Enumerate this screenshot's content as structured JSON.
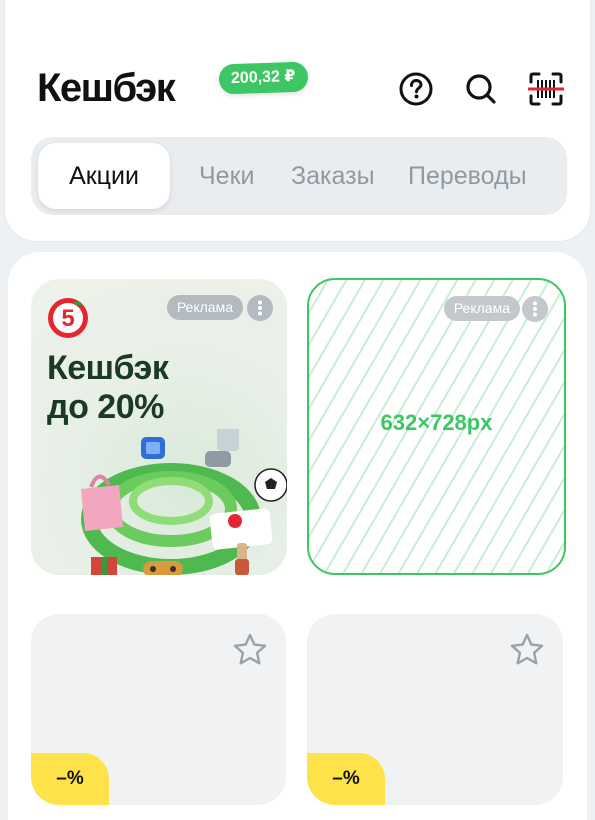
{
  "header": {
    "title": "Кешбэк",
    "balance": "200,32 ₽",
    "icons": [
      "help-icon",
      "search-icon",
      "scan-icon"
    ]
  },
  "tabs": [
    {
      "label": "Акции",
      "active": true
    },
    {
      "label": "Чеки",
      "active": false
    },
    {
      "label": "Заказы",
      "active": false
    },
    {
      "label": "Переводы",
      "active": false
    }
  ],
  "promo_card": {
    "ad_label": "Реклама",
    "logo_text": "5",
    "headline_line1": "Кешбэк",
    "headline_line2": "до 20%"
  },
  "placeholder_card": {
    "ad_label": "Реклама",
    "size_text": "632×728px"
  },
  "offers": [
    {
      "discount": "–%"
    },
    {
      "discount": "–%"
    }
  ],
  "colors": {
    "accent_green": "#3cc764",
    "discount_yellow": "#fde24a",
    "brand_red": "#e3262f"
  }
}
